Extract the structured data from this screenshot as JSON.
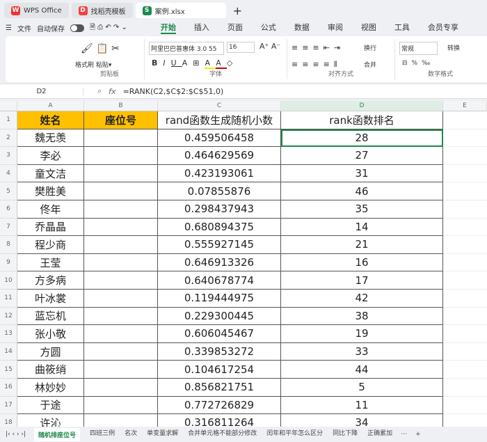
{
  "tabs": [
    {
      "label": "WPS Office"
    },
    {
      "label": "找稻壳模板"
    },
    {
      "label": "案例.xlsx"
    }
  ],
  "menubar": {
    "file": "文件",
    "autosave": "自动保存",
    "menus": [
      "开始",
      "插入",
      "页面",
      "公式",
      "数据",
      "审阅",
      "视图",
      "工具",
      "会员专享"
    ]
  },
  "ribbon": {
    "format_painter": "格式刷",
    "paste": "粘贴",
    "clipboard": "剪贴板",
    "font_name": "阿里巴巴普惠体 3.0 55",
    "font_size": "16",
    "font": "字体",
    "wrap": "换行",
    "merge": "合并",
    "align": "对齐方式",
    "num_fmt": "常规",
    "convert": "转换",
    "number": "数字格式"
  },
  "formula_bar": {
    "cell": "D2",
    "fx": "fx",
    "formula": "=RANK(C2,$C$2:$C$51,0)"
  },
  "columns": [
    "A",
    "B",
    "C",
    "D",
    "E"
  ],
  "headers": [
    "姓名",
    "座位号",
    "rand函数生成随机小数",
    "rank函数排名"
  ],
  "rows": [
    [
      "魏无羡",
      "0.459506458",
      "28"
    ],
    [
      "李必",
      "0.464629569",
      "27"
    ],
    [
      "童文洁",
      "0.423193061",
      "31"
    ],
    [
      "樊胜美",
      "0.07855876",
      "46"
    ],
    [
      "佟年",
      "0.298437943",
      "35"
    ],
    [
      "乔晶晶",
      "0.680894375",
      "14"
    ],
    [
      "程少商",
      "0.555927145",
      "21"
    ],
    [
      "王莹",
      "0.646913326",
      "16"
    ],
    [
      "方多病",
      "0.640678774",
      "17"
    ],
    [
      "叶冰裳",
      "0.119444975",
      "42"
    ],
    [
      "蓝忘机",
      "0.229300445",
      "38"
    ],
    [
      "张小敬",
      "0.606045467",
      "19"
    ],
    [
      "方圆",
      "0.339853272",
      "33"
    ],
    [
      "曲筱绡",
      "0.104617254",
      "44"
    ],
    [
      "林妙妙",
      "0.856821751",
      "5"
    ],
    [
      "于途",
      "0.772726829",
      "11"
    ],
    [
      "许沁",
      "0.316811264",
      "34"
    ]
  ],
  "sheets": [
    "随机排座位号",
    "四班三例",
    "名次",
    "单变量求解",
    "合并单元格不能部分修改",
    "闰年和平年怎么区分",
    "同比下降",
    "正确累加"
  ]
}
